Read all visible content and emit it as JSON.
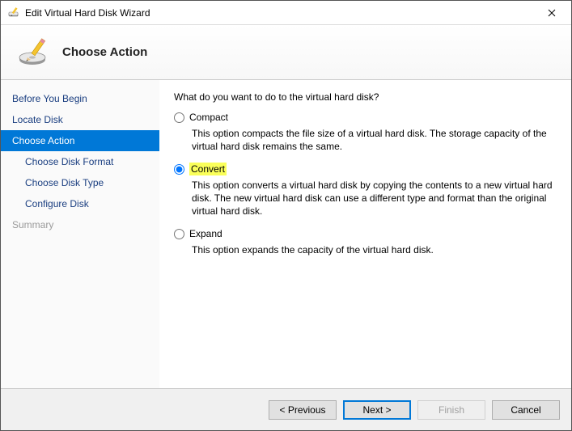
{
  "window": {
    "title": "Edit Virtual Hard Disk Wizard"
  },
  "header": {
    "heading": "Choose Action"
  },
  "sidebar": {
    "items": [
      {
        "label": "Before You Begin",
        "state": "normal"
      },
      {
        "label": "Locate Disk",
        "state": "normal"
      },
      {
        "label": "Choose Action",
        "state": "selected"
      },
      {
        "label": "Choose Disk Format",
        "state": "sub"
      },
      {
        "label": "Choose Disk Type",
        "state": "sub"
      },
      {
        "label": "Configure Disk",
        "state": "sub"
      },
      {
        "label": "Summary",
        "state": "disabled"
      }
    ]
  },
  "content": {
    "prompt": "What do you want to do to the virtual hard disk?",
    "options": [
      {
        "id": "compact",
        "label": "Compact",
        "description": "This option compacts the file size of a virtual hard disk. The storage capacity of the virtual hard disk remains the same.",
        "selected": false,
        "highlight": false
      },
      {
        "id": "convert",
        "label": "Convert",
        "description": "This option converts a virtual hard disk by copying the contents to a new virtual hard disk. The new virtual hard disk can use a different type and format than the original virtual hard disk.",
        "selected": true,
        "highlight": true
      },
      {
        "id": "expand",
        "label": "Expand",
        "description": "This option expands the capacity of the virtual hard disk.",
        "selected": false,
        "highlight": false
      }
    ]
  },
  "footer": {
    "previous": "< Previous",
    "next": "Next >",
    "finish": "Finish",
    "cancel": "Cancel"
  }
}
